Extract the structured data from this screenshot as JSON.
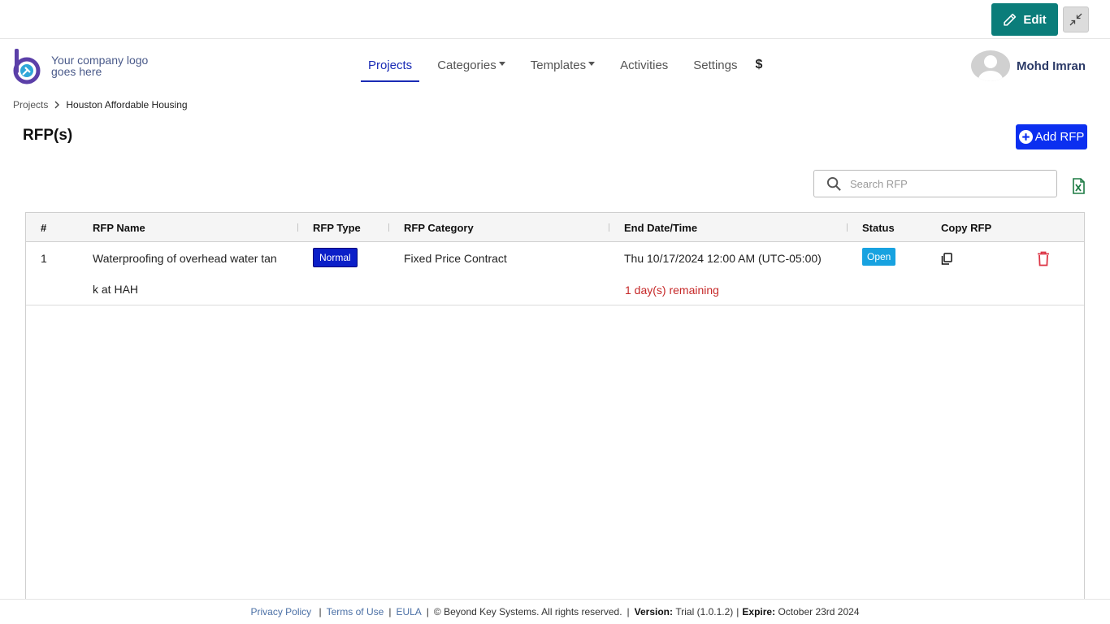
{
  "header": {
    "edit_label": "Edit"
  },
  "brand": {
    "logo_line1": "Your company logo",
    "logo_line2": "goes here",
    "logo_color": "#5b3fa8"
  },
  "nav": {
    "items": [
      {
        "label": "Projects",
        "active": true
      },
      {
        "label": "Categories",
        "dropdown": true
      },
      {
        "label": "Templates",
        "dropdown": true
      },
      {
        "label": "Activities"
      },
      {
        "label": "Settings"
      }
    ],
    "pricing_symbol": "$"
  },
  "user": {
    "name": "Mohd Imran"
  },
  "breadcrumb": {
    "root": "Projects",
    "current": "Houston Affordable Housing"
  },
  "page": {
    "title": "RFP(s)",
    "add_button": "Add RFP"
  },
  "search": {
    "placeholder": "Search RFP"
  },
  "table": {
    "columns": [
      "#",
      "RFP Name",
      "RFP Type",
      "RFP Category",
      "End Date/Time",
      "Status",
      "Copy RFP"
    ],
    "rows": [
      {
        "index": "1",
        "name_line1": "Waterproofing of overhead water tan",
        "name_line2": "k at HAH",
        "type": "Normal",
        "category": "Fixed Price Contract",
        "end_date": "Thu 10/17/2024 12:00 AM (UTC-05:00)",
        "remaining": "1 day(s) remaining",
        "status": "Open"
      }
    ]
  },
  "footer": {
    "privacy": "Privacy Policy",
    "terms": "Terms of Use",
    "eula": "EULA",
    "copyright": "© Beyond Key Systems. All rights reserved.",
    "version_label": "Version:",
    "version_value": "Trial (1.0.1.2)",
    "expire_label": "Expire:",
    "expire_value": "October 23rd 2024"
  },
  "colors": {
    "edit_button": "#0b7d7a",
    "primary": "#0b2ff0",
    "active_nav": "#1a2bb5",
    "badge_normal": "#0b1fc8",
    "badge_open": "#17a2e0",
    "danger": "#c62828",
    "excel": "#1d7b44"
  }
}
